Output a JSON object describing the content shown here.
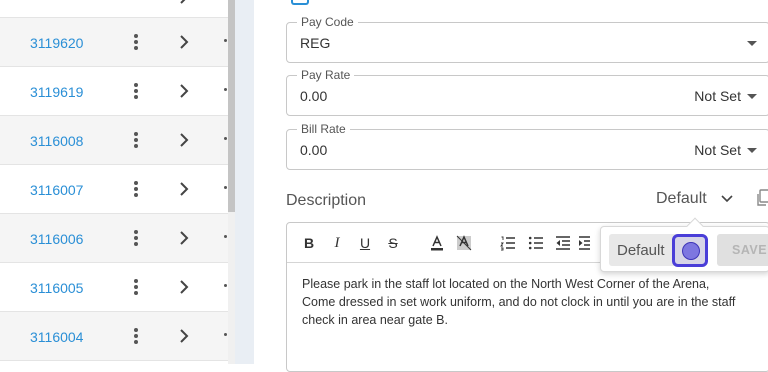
{
  "list": {
    "rows": [
      {
        "id": "3119620"
      },
      {
        "id": "3119619"
      },
      {
        "id": "3116008"
      },
      {
        "id": "3116007"
      },
      {
        "id": "3116006"
      },
      {
        "id": "3116005"
      },
      {
        "id": "3116004"
      }
    ]
  },
  "form": {
    "pay_code": {
      "label": "Pay Code",
      "value": "REG"
    },
    "pay_rate": {
      "label": "Pay Rate",
      "value": "0.00",
      "unit": "Not Set"
    },
    "bill_rate": {
      "label": "Bill Rate",
      "value": "0.00",
      "unit": "Not Set"
    }
  },
  "description": {
    "label": "Description",
    "template": "Default",
    "toolbar": {
      "bold": "B",
      "italic": "I",
      "underline": "U",
      "strike": "S"
    },
    "text": "Please park in the staff lot located on the North West Corner of the Arena, Come dressed in set work uniform, and do not clock in until you are in the staff check in area near gate B."
  },
  "popover": {
    "input_value": "Default",
    "save_label": "SAVE"
  },
  "colors": {
    "link": "#2a8fd6",
    "focus": "#4a3ed8"
  }
}
